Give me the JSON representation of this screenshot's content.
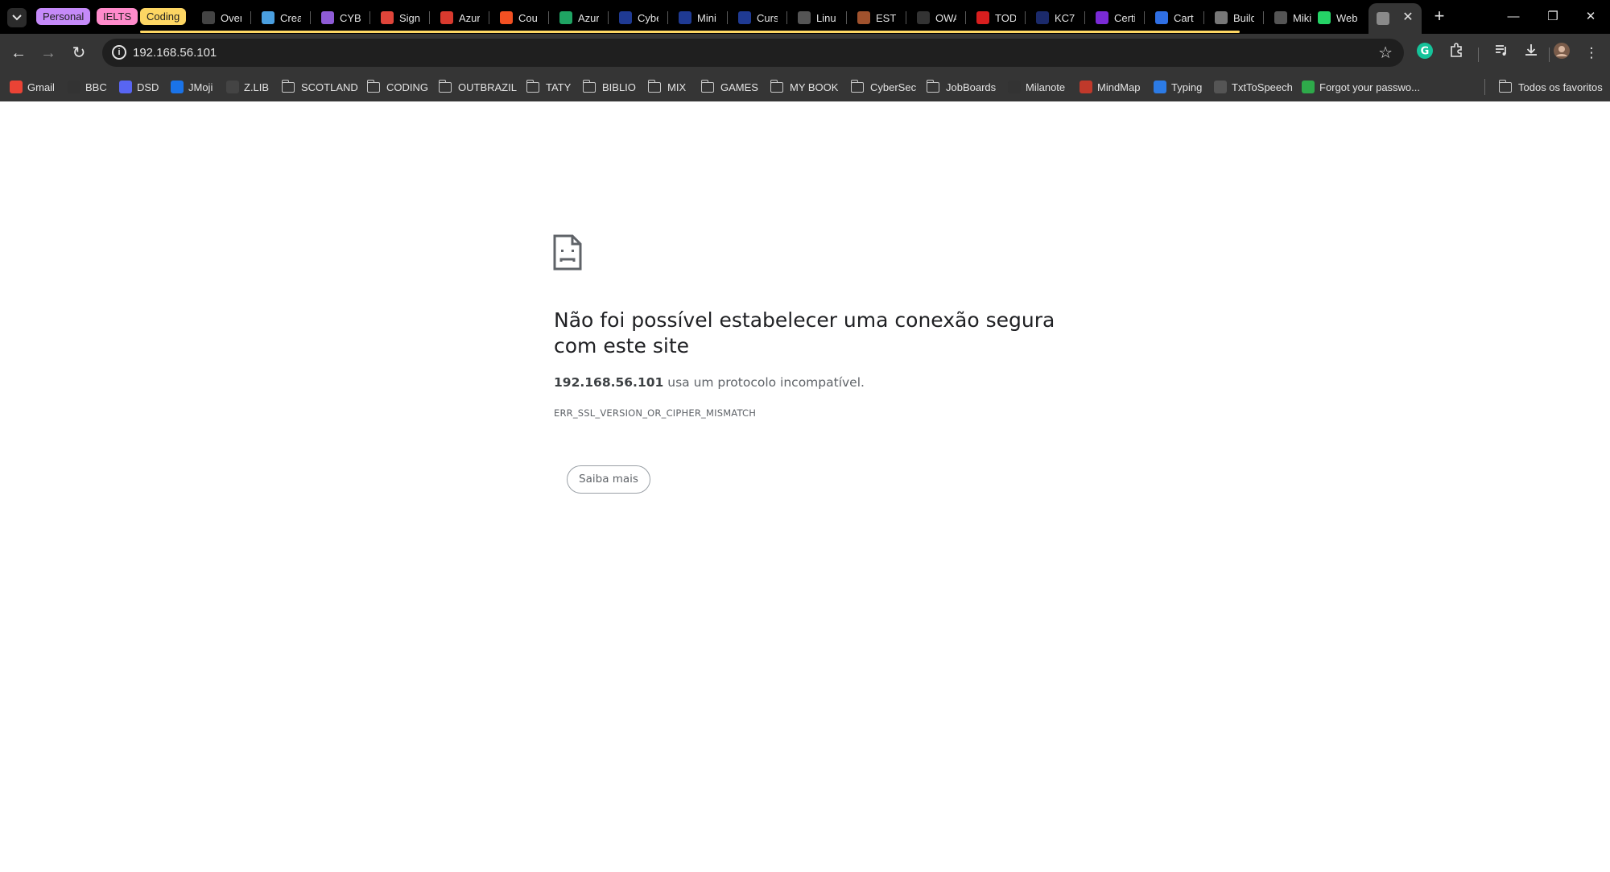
{
  "tab_groups": [
    {
      "label": "Personal",
      "color": "#c58af9"
    },
    {
      "label": "IELTS",
      "color": "#ff8bcb"
    },
    {
      "label": "Coding",
      "color": "#fdd663"
    }
  ],
  "tabs": [
    {
      "title": "Over",
      "icon": "github-icon",
      "color": "#444444"
    },
    {
      "title": "Crea",
      "icon": "globe-icon",
      "color": "#4a9fe0"
    },
    {
      "title": "CYB",
      "icon": "robot-icon",
      "color": "#8e5bd6"
    },
    {
      "title": "Sign",
      "icon": "shield-icon",
      "color": "#e0453a"
    },
    {
      "title": "Azur",
      "icon": "butterfly-icon",
      "color": "#d83a2e"
    },
    {
      "title": "Cou",
      "icon": "microsoft-icon",
      "color": "#f25022"
    },
    {
      "title": "Azur",
      "icon": "drive-icon",
      "color": "#1fa463"
    },
    {
      "title": "Cybe",
      "icon": "a-icon",
      "color": "#1f3a93"
    },
    {
      "title": "Mini",
      "icon": "a-icon",
      "color": "#1f3a93"
    },
    {
      "title": "Curs",
      "icon": "a-icon",
      "color": "#1f3a93"
    },
    {
      "title": "Linu",
      "icon": "penguin-icon",
      "color": "#555555"
    },
    {
      "title": "ESTU",
      "icon": "brush-icon",
      "color": "#a0522d"
    },
    {
      "title": "OWA",
      "icon": "compass-icon",
      "color": "#333333"
    },
    {
      "title": "TOD",
      "icon": "sf-icon",
      "color": "#d81e1e"
    },
    {
      "title": "KC7",
      "icon": "kc7-icon",
      "color": "#1b2a6b"
    },
    {
      "title": "Certi",
      "icon": "link-icon",
      "color": "#7a2ad6"
    },
    {
      "title": "Cart",
      "icon": "q-icon",
      "color": "#2f6fe4"
    },
    {
      "title": "Build",
      "icon": "tools-icon",
      "color": "#777777"
    },
    {
      "title": "Miki",
      "icon": "miki-icon",
      "color": "#555555"
    },
    {
      "title": "Web",
      "icon": "phone-icon",
      "color": "#25d366"
    },
    {
      "title": "",
      "icon": "globe-icon",
      "color": "#8a8a8a"
    }
  ],
  "address_bar": {
    "url": "192.168.56.101"
  },
  "bookmarks": [
    {
      "label": "Gmail",
      "icon": "gmail-icon",
      "color": "#ea4335"
    },
    {
      "label": "BBC",
      "icon": "bbc-icon",
      "color": "#333333"
    },
    {
      "label": "DSD",
      "icon": "discord-icon",
      "color": "#5865f2"
    },
    {
      "label": "JMoji",
      "icon": "e-icon",
      "color": "#1a73e8"
    },
    {
      "label": "Z.LIB",
      "icon": "z-icon",
      "color": "#444444"
    },
    {
      "label": "SCOTLAND",
      "icon": "folder-icon"
    },
    {
      "label": "CODING",
      "icon": "folder-icon"
    },
    {
      "label": "OUTBRAZIL",
      "icon": "folder-icon"
    },
    {
      "label": "TATY",
      "icon": "folder-icon"
    },
    {
      "label": "BIBLIO",
      "icon": "folder-icon"
    },
    {
      "label": "MIX",
      "icon": "folder-icon"
    },
    {
      "label": "GAMES",
      "icon": "folder-icon"
    },
    {
      "label": "MY BOOK",
      "icon": "folder-icon"
    },
    {
      "label": "CyberSec",
      "icon": "folder-icon"
    },
    {
      "label": "JobBoards",
      "icon": "folder-icon"
    },
    {
      "label": "Milanote",
      "icon": "milanote-icon",
      "color": "#333333"
    },
    {
      "label": "MindMap",
      "icon": "mindmap-icon",
      "color": "#c0392b"
    },
    {
      "label": "Typing",
      "icon": "t-icon",
      "color": "#2c7be5"
    },
    {
      "label": "TxtToSpeech",
      "icon": "home-icon",
      "color": "#555555"
    },
    {
      "label": "Forgot your passwo...",
      "icon": "key-icon",
      "color": "#2eaa4a"
    }
  ],
  "all_bookmarks": "Todos os favoritos",
  "error": {
    "title": "Não foi possível estabelecer uma conexão segura com este site",
    "host": "192.168.56.101",
    "description": " usa um protocolo incompatível.",
    "code": "ERR_SSL_VERSION_OR_CIPHER_MISMATCH",
    "learn_more": "Saiba mais"
  }
}
